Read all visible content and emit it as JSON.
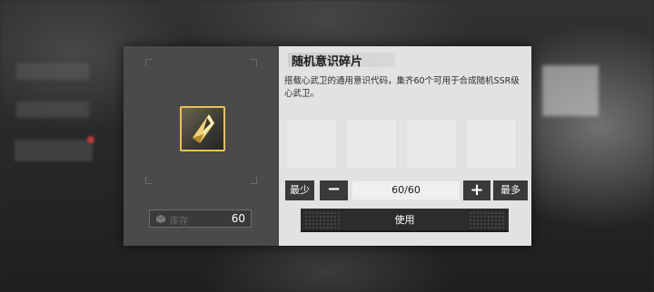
{
  "item": {
    "name": "随机意识碎片",
    "description": "搭载心武卫的通用意识代码，集齐60个可用于合成随机SSR级心武卫。",
    "icon": "crystal-shard-icon",
    "rarity_color": "#e8c15a"
  },
  "stock": {
    "label": "库存",
    "value": "60",
    "icon": "box-icon"
  },
  "quantity": {
    "min_label": "最少",
    "minus_label": "−",
    "value": "60/60",
    "plus_label": "+",
    "max_label": "最多"
  },
  "actions": {
    "use_label": "使用"
  },
  "colors": {
    "panel_left": "#4a4a4a",
    "panel_right": "#e2e2e2",
    "button_dark": "#3a3a3a"
  }
}
